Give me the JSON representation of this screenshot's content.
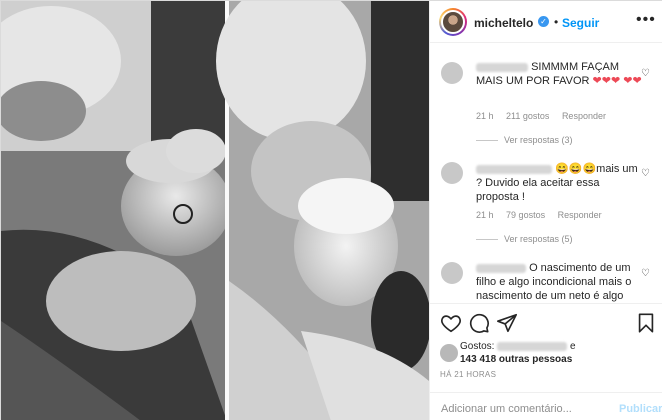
{
  "header": {
    "username": "micheltelo",
    "verified_glyph": "✓",
    "separator": "•",
    "follow_label": "Seguir",
    "more_glyph": "•••"
  },
  "comments": [
    {
      "text": "SIMMMM FAÇAM MAIS UM POR FAVOR",
      "emoji": "❤❤❤ ❤❤",
      "time": "21 h",
      "likes": "211 gostos",
      "reply_label": "Responder",
      "view_replies": "Ver respostas (3)"
    },
    {
      "emoji": "😄😄😄",
      "text": "mais um ? Duvido ela aceitar essa proposta !",
      "time": "21 h",
      "likes": "79 gostos",
      "reply_label": "Responder",
      "view_replies": "Ver respostas (5)"
    },
    {
      "text": "O nascimento de um filho e algo incondicional mais o nascimento de um neto é algo"
    }
  ],
  "likes": {
    "prefix": "Gostos:",
    "connector": "e",
    "others": "143 418 outras pessoas"
  },
  "timestamp": "HÁ 21 HORAS",
  "add_comment": {
    "placeholder": "Adicionar um comentário...",
    "publish_label": "Publicar"
  },
  "icons": {
    "like": "heart-icon",
    "comment": "comment-icon",
    "share": "share-icon",
    "save": "bookmark-icon"
  },
  "colors": {
    "link_blue": "#0095f6",
    "publish_disabled": "#b2dffc",
    "heart_red": "#ed4956",
    "muted": "#8e8e8e"
  }
}
